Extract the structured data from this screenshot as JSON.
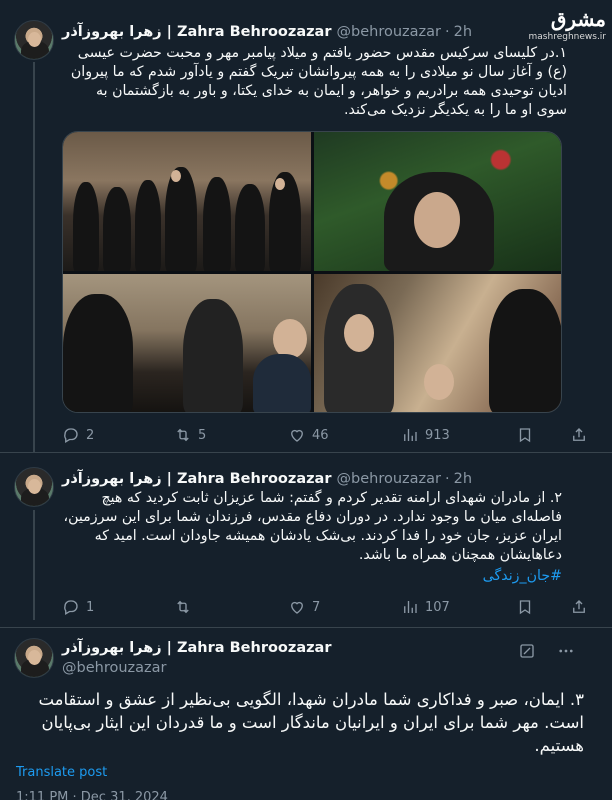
{
  "watermark": {
    "logo": "مشرق",
    "url": "mashreghnews.ir"
  },
  "tweets": [
    {
      "name": "زهرا بهروزآذر | Zahra Behroozazar",
      "handle": "@behrouzazar",
      "time": "2h",
      "text": "١.در کلیسای سرکیس مقدس حضور یافتم و میلاد پیامبر مهر و محبت حضرت عیسی (ع) و آغاز سال نو میلادی را به همه پیروانشان تبریک گفتم و یادآور شدم که ما پیروان ادیان توحیدی همه برادریم و خواهر، و ایمان به خدای یکتا، و باور به بازگشتمان به سوی او ما را به یکدیگر نزدیک می‌کند.",
      "replies": "2",
      "retweets": "5",
      "likes": "46",
      "views": "913"
    },
    {
      "name": "زهرا بهروزآذر | Zahra Behroozazar",
      "handle": "@behrouzazar",
      "time": "2h",
      "text": "٢. از مادران شهدای ارامنه تقدیر کردم و گفتم: شما عزیزان ثابت کردید که هیچ فاصله‌ای میان ما وجود ندارد. در دوران دفاع مقدس، فرزندان شما برای این سرزمین، ایران عزیز، جان خود را فدا کردند. بی‌شک یادشان همیشه جاودان است. امید که دعاهایشان همچنان همراه ما باشد.",
      "hashtag": "#جان_زندگی",
      "replies": "1",
      "retweets": "",
      "likes": "7",
      "views": "107"
    },
    {
      "name": "زهرا بهروزآذر | Zahra Behroozazar",
      "handle": "@behrouzazar",
      "text": "٣. ایمان، صبر و فداکاری شما مادران شهدا، الگویی بی‌نظیر از عشق و استقامت است. مهر شما برای ایران و ایرانیان ماندگار است و ما قدردان این ایثار بی‌پایان هستیم.",
      "translate_label": "Translate post",
      "timestamp": "1:11 PM · Dec 31, 2024"
    }
  ]
}
